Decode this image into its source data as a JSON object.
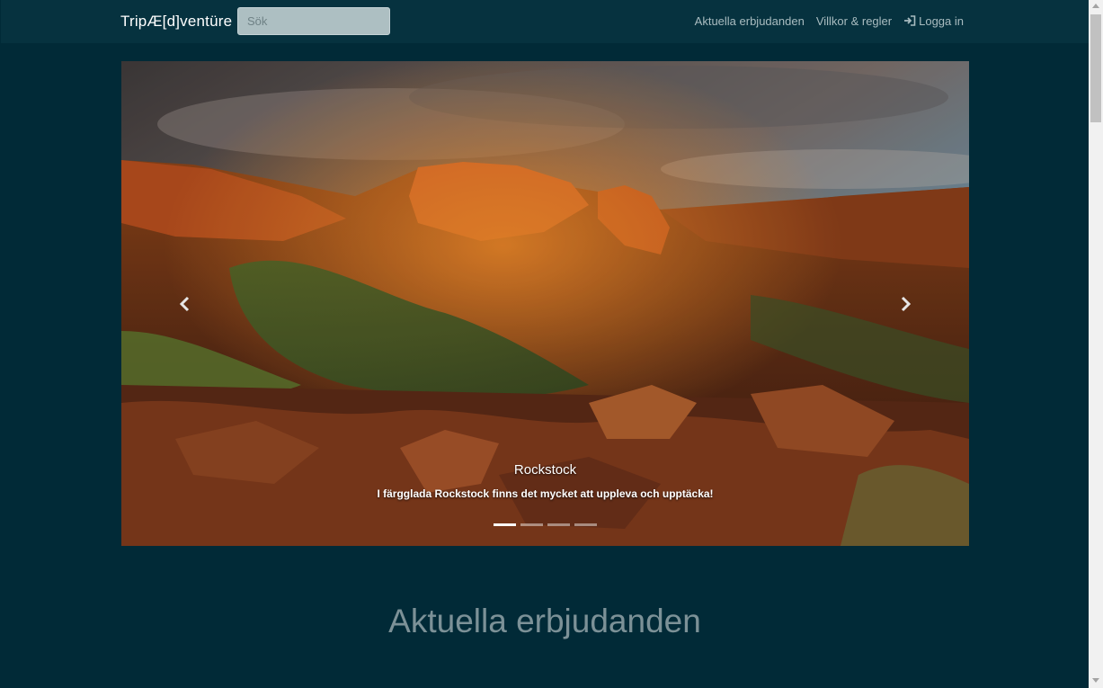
{
  "navbar": {
    "brand": "TripÆ[d]ventüre",
    "search_placeholder": "Sök",
    "links": [
      {
        "label": "Aktuella erbjudanden"
      },
      {
        "label": "Villkor & regler"
      },
      {
        "label": "Logga in",
        "icon": "sign-in-icon"
      }
    ]
  },
  "carousel": {
    "caption_title": "Rockstock",
    "caption_text": "I färgglada Rockstock finns det mycket att uppleva och upptäcka!",
    "slide_count": 4,
    "active_slide": 1,
    "prev_icon": "chevron-left-icon",
    "next_icon": "chevron-right-icon"
  },
  "section": {
    "title": "Aktuella erbjudanden"
  },
  "colors": {
    "page_bg": "#012a37",
    "navbar_bg": "#06323f",
    "section_title": "#7c9197"
  }
}
